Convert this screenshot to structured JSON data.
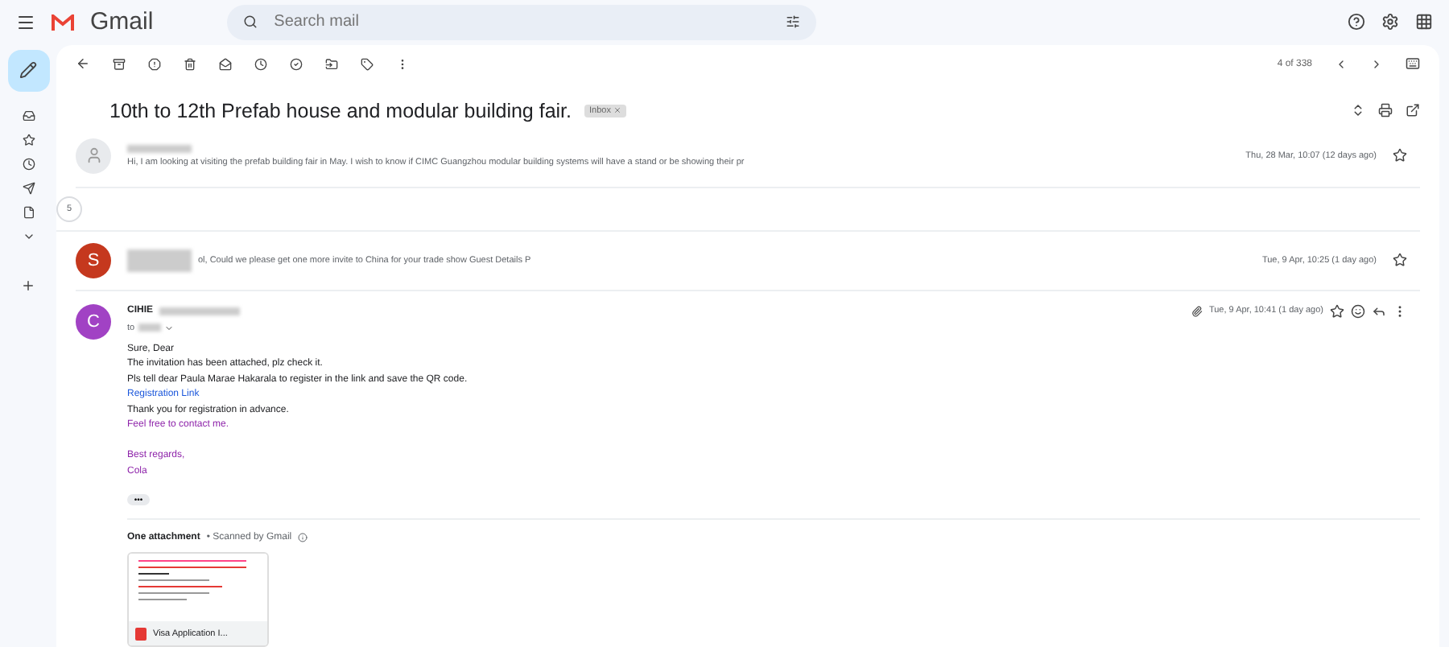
{
  "app": {
    "name": "Gmail"
  },
  "search": {
    "placeholder": "Search mail"
  },
  "toolbar": {
    "pager": "4 of 338"
  },
  "thread": {
    "subject": "10th to 12th Prefab house and modular building fair.",
    "label": "Inbox"
  },
  "messages": [
    {
      "kind": "collapsed",
      "color": "#e8eaed",
      "snippet": "Hi, I am looking at visiting the prefab building fair in May. I wish to know if CIMC Guangzhou modular building systems will have a stand or be showing their pr",
      "date": "Thu, 28 Mar, 10:07 (12 days ago)",
      "starred": false
    },
    {
      "kind": "hidden_count",
      "count": "5"
    },
    {
      "kind": "collapsed",
      "avatar_letter": "S",
      "color": "#c5381e",
      "snippet": "ol, Could we please get one more invite to China for your trade show Guest Details P",
      "date": "Tue, 9 Apr, 10:25 (1 day ago)",
      "starred": false
    }
  ],
  "open_message": {
    "avatar_letter": "C",
    "color": "#a142c4",
    "sender": "CIHIE",
    "to": "to",
    "date": "Tue, 9 Apr, 10:41 (1 day ago)",
    "starred": false,
    "body": [
      {
        "kind": "text",
        "text": "Sure, Dear"
      },
      {
        "kind": "text",
        "text": "The invitation has been attached, plz check it."
      },
      {
        "kind": "text",
        "text": "Pls tell dear Paula Marae Hakarala to register in the link and save the QR code."
      },
      {
        "kind": "link",
        "text": "Registration Link"
      },
      {
        "kind": "text",
        "text": "Thank you for registration in advance."
      },
      {
        "kind": "signature",
        "text": "Feel free to contact me."
      },
      {
        "kind": "gap"
      },
      {
        "kind": "signature",
        "text": "Best regards,"
      },
      {
        "kind": "signature",
        "text": "Cola"
      }
    ],
    "more": "•••",
    "attachments_heading": "One attachment",
    "scan_note": "• Scanned by Gmail",
    "attachment": {
      "name": "Visa Application I..."
    }
  }
}
